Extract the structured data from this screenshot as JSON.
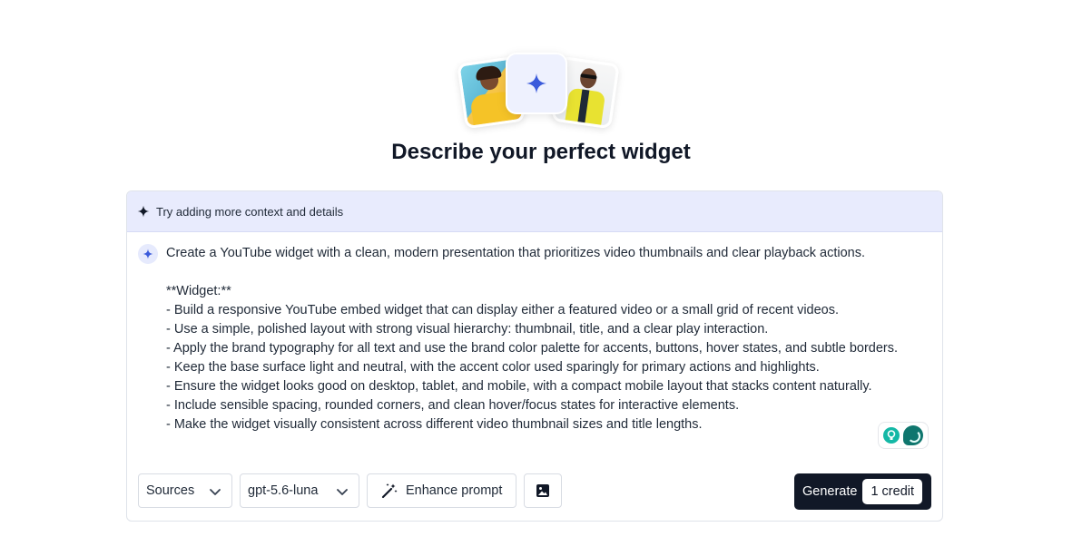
{
  "hero": {
    "images": [
      "woman-yellow-hoodie-photo",
      "man-yellow-jacket-photo"
    ],
    "center_icon": "sparkle-icon"
  },
  "title": "Describe your perfect widget",
  "hint": {
    "icon": "sparkle-icon",
    "text": "Try adding more context and details"
  },
  "prompt": {
    "text": "Create a YouTube widget with a clean, modern presentation that prioritizes video thumbnails and clear playback actions.\n\n**Widget:**\n- Build a responsive YouTube embed widget that can display either a featured video or a small grid of recent videos.\n- Use a simple, polished layout with strong visual hierarchy: thumbnail, title, and a clear play interaction.\n- Apply the brand typography for all text and use the brand color palette for accents, buttons, hover states, and subtle borders.\n- Keep the base surface light and neutral, with the accent color used sparingly for primary actions and highlights.\n- Ensure the widget looks good on desktop, tablet, and mobile, with a compact mobile layout that stacks content naturally.\n- Include sensible spacing, rounded corners, and clean hover/focus states for interactive elements.\n- Make the widget visually consistent across different video thumbnail sizes and title lengths."
  },
  "toolbar": {
    "sources_label": "Sources",
    "model_label": "gpt-5.6-luna",
    "enhance_label": "Enhance prompt",
    "generate_label": "Generate",
    "credit_label": "1 credit"
  },
  "colors": {
    "accent": "#3b5bdb",
    "hint_bg": "#e8ebfd",
    "generate_bg": "#111827",
    "assist_teal": "#14b8a6"
  }
}
